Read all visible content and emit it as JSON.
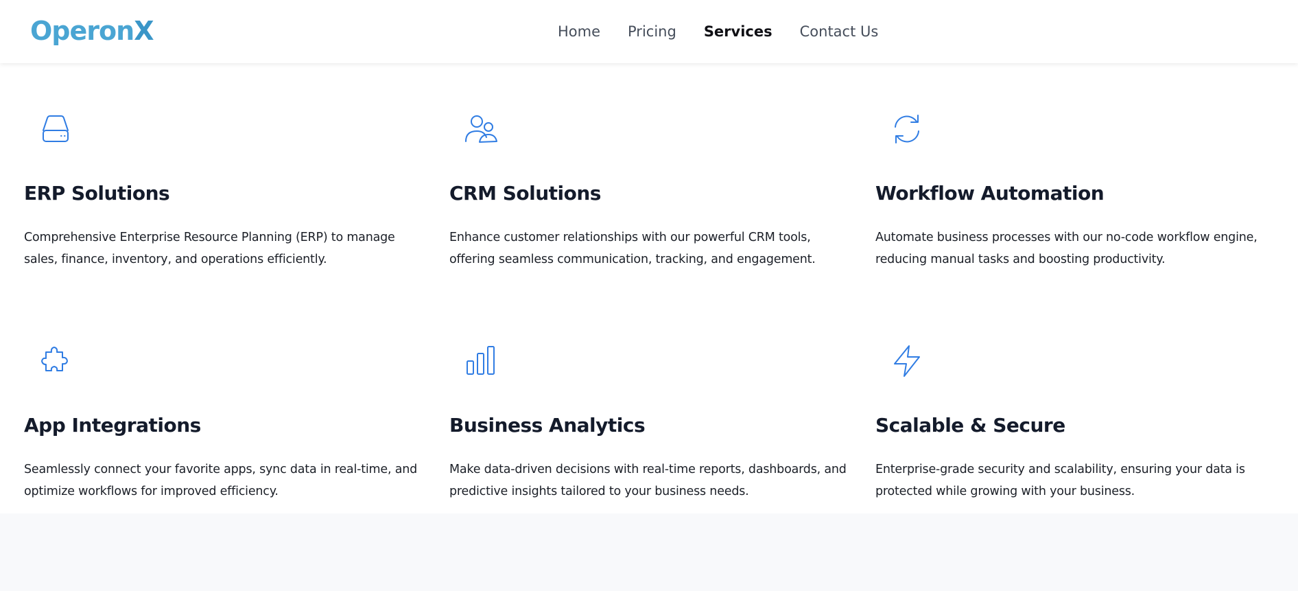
{
  "brand": {
    "logo_main": "Operon",
    "logo_accent": "X",
    "color": "#4aa5d3"
  },
  "nav": {
    "items": [
      {
        "label": "Home"
      },
      {
        "label": "Pricing"
      },
      {
        "label": "Services"
      },
      {
        "label": "Contact Us"
      }
    ],
    "active": "Services"
  },
  "services": [
    {
      "icon": "hard-drive-icon",
      "title": "ERP Solutions",
      "description": "Comprehensive Enterprise Resource Planning (ERP) to manage sales, finance, inventory, and operations efficiently."
    },
    {
      "icon": "users-icon",
      "title": "CRM Solutions",
      "description": "Enhance customer relationships with our powerful CRM tools, offering seamless communication, tracking, and engagement."
    },
    {
      "icon": "refresh-icon",
      "title": "Workflow Automation",
      "description": "Automate business processes with our no-code workflow engine, reducing manual tasks and boosting productivity."
    },
    {
      "icon": "puzzle-icon",
      "title": "App Integrations",
      "description": "Seamlessly connect your favorite apps, sync data in real-time, and optimize workflows for improved efficiency."
    },
    {
      "icon": "bar-chart-icon",
      "title": "Business Analytics",
      "description": "Make data-driven decisions with real-time reports, dashboards, and predictive insights tailored to your business needs."
    },
    {
      "icon": "lightning-icon",
      "title": "Scalable & Secure",
      "description": "Enterprise-grade security and scalability, ensuring your data is protected while growing with your business."
    }
  ],
  "colors": {
    "accent": "#2f7ce3",
    "heading": "#141b2b",
    "body_text": "#1b1f27",
    "nav_text": "#454d5a",
    "page_bg": "#f8f9fb"
  }
}
